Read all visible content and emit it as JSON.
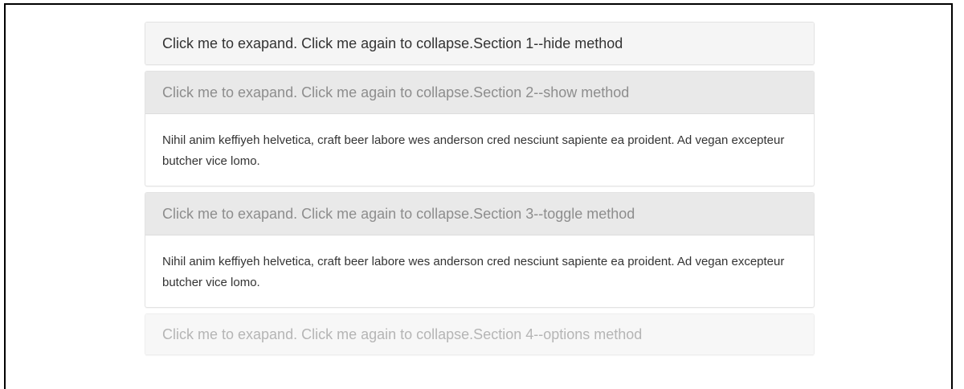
{
  "accordion": {
    "sections": [
      {
        "title": "Click me to exapand. Click me again to collapse.Section 1--hide method"
      },
      {
        "title": "Click me to exapand. Click me again to collapse.Section 2--show method",
        "body": "Nihil anim keffiyeh helvetica, craft beer labore wes anderson cred nesciunt sapiente ea proident. Ad vegan excepteur butcher vice lomo."
      },
      {
        "title": "Click me to exapand. Click me again to collapse.Section 3--toggle method",
        "body": "Nihil anim keffiyeh helvetica, craft beer labore wes anderson cred nesciunt sapiente ea proident. Ad vegan excepteur butcher vice lomo."
      },
      {
        "title": "Click me to exapand. Click me again to collapse.Section 4--options method"
      }
    ]
  }
}
